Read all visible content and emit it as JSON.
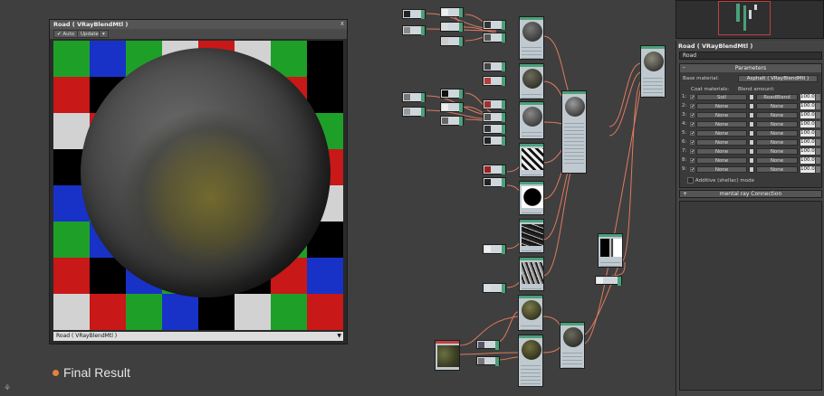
{
  "preview": {
    "title": "Road  ( VRayBlendMtl )",
    "close": "x",
    "toolbar": {
      "auto_label": "Auto",
      "update_label": "Update",
      "pin_label": "▾"
    },
    "dropdown_value": "Road  ( VRayBlendMtl )",
    "dropdown_arrow": "▼",
    "checker_colors": [
      "#1ea028",
      "#1832c8",
      "#c81818",
      "#d2d2d2",
      "#000000"
    ]
  },
  "caption": "Final Result",
  "logo": "⚘",
  "panel": {
    "title": "Road  ( VRayBlendMtl )",
    "name_value": "Road",
    "parameters_header": "Parameters",
    "collapse_symbol": "-",
    "base_material_label": "Base material:",
    "base_material_value": "Asphalt  ( VRayBlendMtl )",
    "coat_materials_label": "Coat materials:",
    "blend_amount_label": "Blend amount:",
    "rows": [
      {
        "num": "1:",
        "coat": "Soil",
        "blend": "RoadBlend",
        "value": "100.0"
      },
      {
        "num": "2:",
        "coat": "None",
        "blend": "None",
        "value": "100.0"
      },
      {
        "num": "3:",
        "coat": "None",
        "blend": "None",
        "value": "100.0"
      },
      {
        "num": "4:",
        "coat": "None",
        "blend": "None",
        "value": "100.0"
      },
      {
        "num": "5:",
        "coat": "None",
        "blend": "None",
        "value": "100.0"
      },
      {
        "num": "6:",
        "coat": "None",
        "blend": "None",
        "value": "100.0"
      },
      {
        "num": "7:",
        "coat": "None",
        "blend": "None",
        "value": "100.0"
      },
      {
        "num": "8:",
        "coat": "None",
        "blend": "None",
        "value": "100.0"
      },
      {
        "num": "9:",
        "coat": "None",
        "blend": "None",
        "value": "100.0"
      }
    ],
    "check_mark": "✔",
    "additive_label": "Additive (shellac) mode",
    "mentalray_label": "mental ray Connection",
    "expand_symbol": "+"
  },
  "colors": {
    "node_header": "#4aa07a",
    "wire": "#e07a5f",
    "node_body": "#bfc9cf",
    "accent": "#e5813a"
  }
}
